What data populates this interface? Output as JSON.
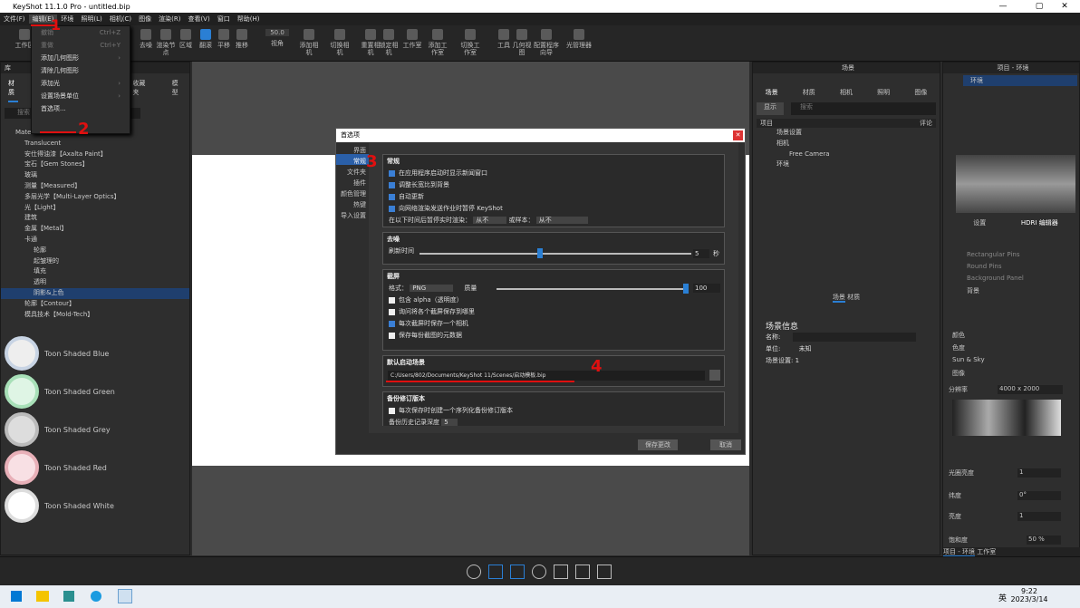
{
  "window": {
    "title": "KeyShot 11.1.0 Pro - untitled.bip"
  },
  "menubar": [
    "文件(F)",
    "编辑(E)",
    "环境",
    "照明(L)",
    "相机(C)",
    "图像",
    "渲染(R)",
    "查看(V)",
    "窗口",
    "帮助(H)"
  ],
  "toolbar": {
    "items": [
      "工作区",
      "去噪",
      "渲染节点",
      "区域",
      "翻滚",
      "平移",
      "推移",
      "视角",
      "添加相机",
      "切换相机",
      "重置相机",
      "锁定相机",
      "工作室",
      "添加工作室",
      "切换工作室",
      "工具",
      "几何视图",
      "配置程序向导",
      "光管理器"
    ],
    "angle": "50.0"
  },
  "edit_menu": {
    "items": [
      {
        "label": "撤销",
        "shortcut": "Ctrl+Z"
      },
      {
        "label": "重做",
        "shortcut": "Ctrl+Y"
      },
      {
        "label": "添加几何图形"
      },
      {
        "label": "清除几何图形"
      },
      {
        "label": "添加光"
      },
      {
        "label": "设置场景单位"
      },
      {
        "label": "首选项..."
      }
    ]
  },
  "library": {
    "tabs": [
      "材质",
      "收藏夹",
      "模型"
    ],
    "search_placeholder": "搜索",
    "tree": [
      "Materials",
      "Translucent",
      "安仕得油漆【Axalta Paint】",
      "宝石【Gem Stones】",
      "玻璃",
      "测量【Measured】",
      "多层光学【Multi-Layer Optics】",
      "光【Light】",
      "建筑",
      "金属【Metal】",
      "卡通",
      "轮廓",
      "起皱理的",
      "填充",
      "透明",
      "阴影&上色",
      "轮廓【Contour】",
      "模具技术【Mold-Tech】"
    ],
    "thumbs": [
      "Toon Shaded Blue",
      "Toon Shaded Green",
      "Toon Shaded Grey",
      "Toon Shaded Red",
      "Toon Shaded White"
    ]
  },
  "dialog": {
    "title": "首选项",
    "nav": [
      "界面",
      "常规",
      "文件夹",
      "插件",
      "颜色管理",
      "热键",
      "导入设置"
    ],
    "general": {
      "title": "常规",
      "opts": [
        "在应用程序启动时显示新闻窗口",
        "调整长宽比到背景",
        "自动更新",
        "向网络渲染发送作业时暂停 KeyShot"
      ],
      "pause_label": "在以下时间后暂停实时渲染：",
      "never": "从不",
      "or_samples": "或样本：",
      "never2": "从不"
    },
    "denoise": {
      "title": "去噪",
      "refresh": "刷新时间",
      "val": "5",
      "unit": "秒"
    },
    "screenshot": {
      "title": "截屏",
      "format_label": "格式：",
      "format": "PNG",
      "quality_label": "质量",
      "quality": "100",
      "opts": [
        "包含 alpha（透明度）",
        "询问将各个截屏保存到哪里",
        "每次截屏时保存一个相机",
        "保存每份截图的元数据"
      ]
    },
    "startup": {
      "title": "默认启动场景",
      "path": "C:/Users/802/Documents/KeyShot 11/Scenes/启动模板.bip"
    },
    "backup": {
      "title": "备份修订版本",
      "opt": "每次保存时创建一个序列化备份修订版本",
      "depth_label": "备份历史记录深度",
      "depth": "5"
    },
    "buttons": {
      "save": "保存更改",
      "cancel": "取消"
    }
  },
  "scene": {
    "title": "场景",
    "tabs": [
      "场景",
      "材质",
      "相机",
      "照明",
      "图像"
    ],
    "show": "显示",
    "search": "搜索",
    "col": "项目",
    "col2": "评论",
    "tree": [
      "场景设置",
      "相机",
      "Free Camera",
      "环境"
    ],
    "subtabs": [
      "场景",
      "材质"
    ],
    "info_title": "场景信息",
    "name_label": "名称:",
    "unit_label": "单位:",
    "unit": "未知",
    "count_label": "场景设置:",
    "count": "1"
  },
  "env": {
    "title": "项目 - 环境",
    "items": [
      "环境"
    ],
    "tabs": [
      "设置",
      "HDRI 编辑器"
    ],
    "pins": [
      "Rectangular Pins",
      "Round Pins",
      "Background Panel",
      "背景"
    ],
    "bg_opts": [
      "颜色",
      "色度",
      "Sun & Sky",
      "图像"
    ],
    "res_label": "分辨率",
    "res": "4000 x 2000",
    "brightness_label": "光圈亮度",
    "brightness": "1",
    "rotation_label": "纬度",
    "rotation": "0°",
    "exposure_label": "亮度",
    "exposure": "1",
    "sat_label": "饱和度",
    "sat": "50 %",
    "bottom_tabs": [
      "项目 - 环境",
      "工作室"
    ]
  },
  "annotations": [
    "1",
    "2",
    "3",
    "4"
  ],
  "taskbar": {
    "time": "9:22",
    "date": "2023/3/14",
    "lang": "英"
  }
}
